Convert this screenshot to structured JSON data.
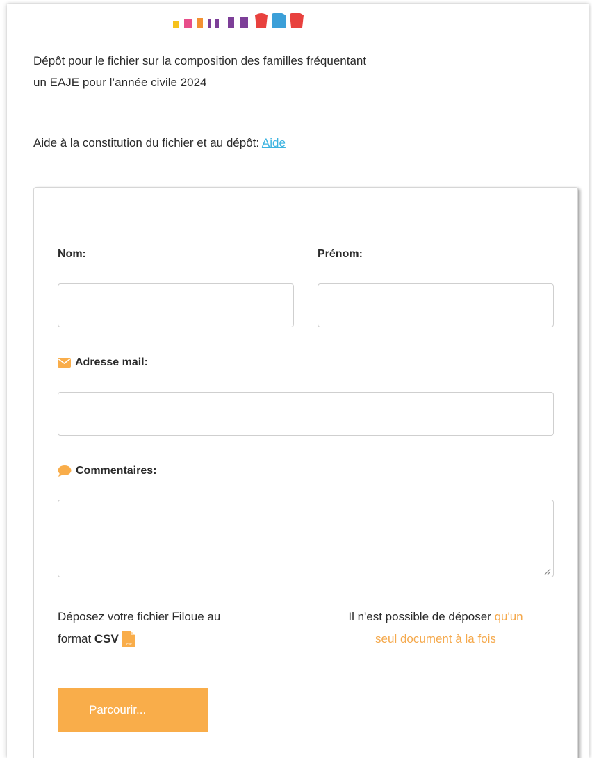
{
  "intro": {
    "line1": "Dépôt pour le fichier sur la composition des familles fréquentant",
    "line2": "un EAJE pour l’année civile 2024"
  },
  "help": {
    "text": "Aide à la constitution du fichier et au dépôt: ",
    "link_label": "Aide"
  },
  "form": {
    "nom_label": "Nom:",
    "nom_value": "",
    "prenom_label": "Prénom:",
    "prenom_value": "",
    "email_label": "Adresse mail:",
    "email_value": "",
    "comment_label": "Commentaires:",
    "comment_value": "",
    "drop_line1": "Déposez votre fichier Filoue au",
    "drop_line2_prefix": "format ",
    "drop_format": "CSV",
    "note_prefix": "Il n'est possible de déposer ",
    "note_highlight_1": "qu'un",
    "note_highlight_2": "seul document à la fois",
    "browse_label": "Parcourir..."
  },
  "icons": {
    "email": "envelope-icon",
    "comment": "speech-bubble-icon",
    "file": "csv-file-icon"
  },
  "colors": {
    "accent": "#f9ad4a",
    "link": "#3bb3e0",
    "text": "#2b2b2b"
  }
}
